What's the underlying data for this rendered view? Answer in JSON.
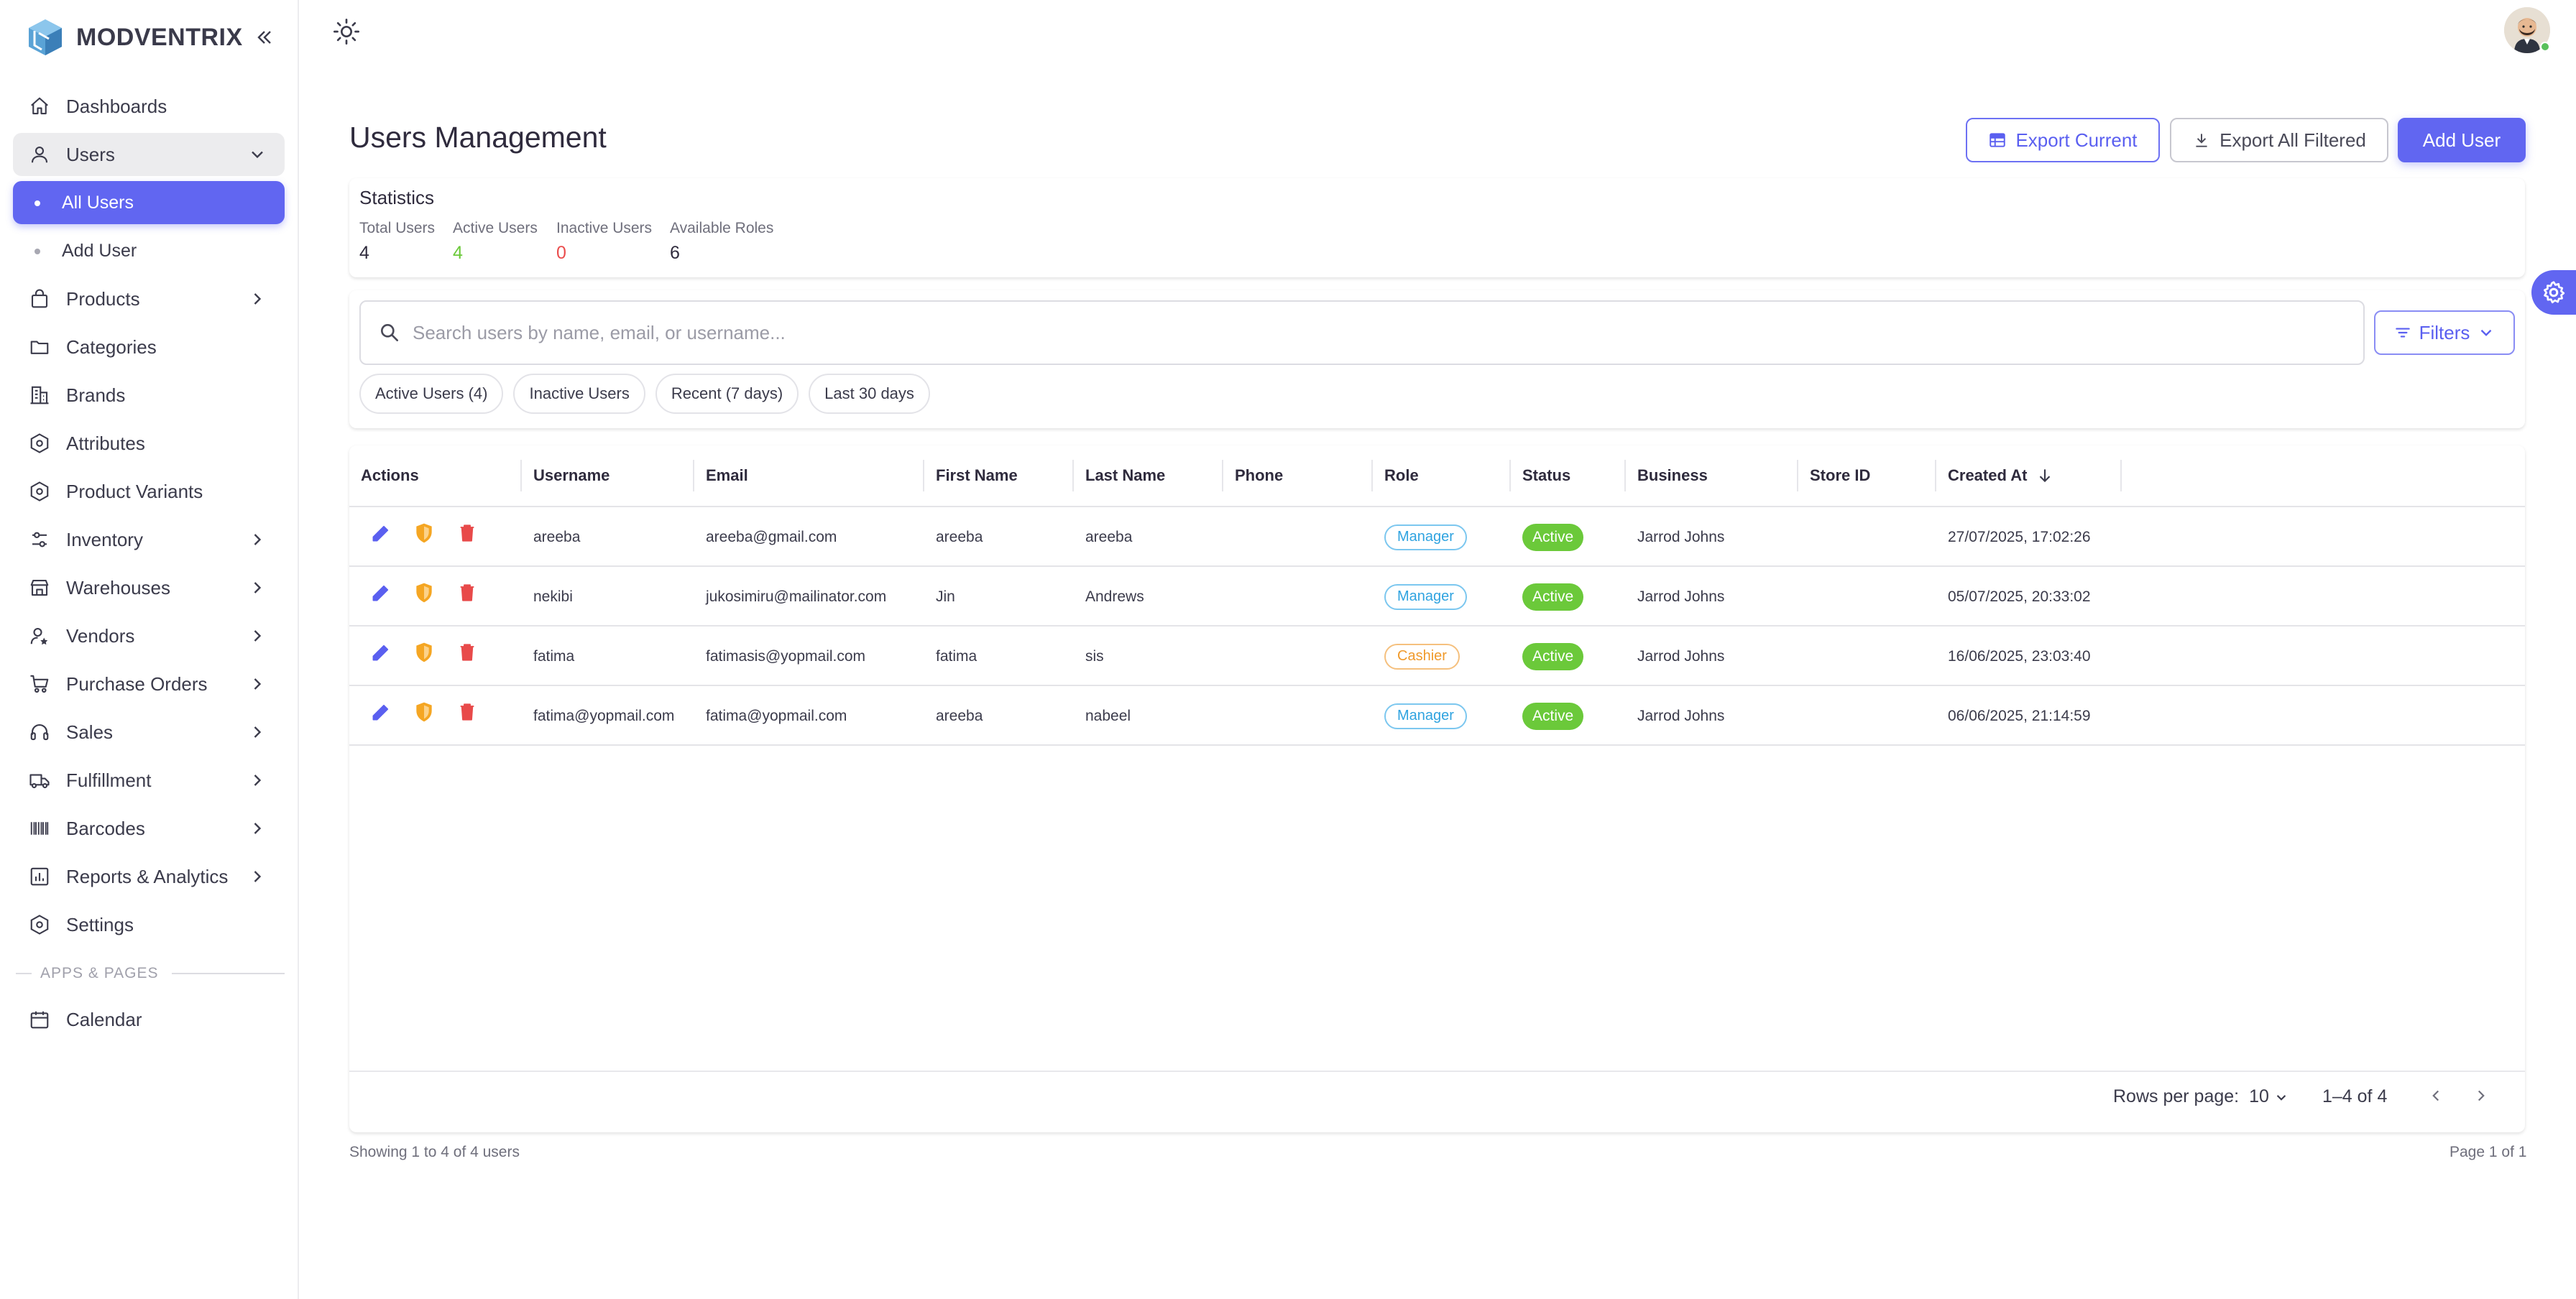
{
  "app": {
    "name": "MODVENTRIX"
  },
  "colors": {
    "accent": "#6166f1",
    "success": "#6bc93a",
    "danger": "#ea4d4d",
    "info": "#2fa3e0",
    "warning": "#f09a2b"
  },
  "sidebar": {
    "items": [
      {
        "label": "Dashboards",
        "icon": "home-icon"
      },
      {
        "label": "Users",
        "icon": "user-icon",
        "expanded": true,
        "children": [
          {
            "label": "All Users",
            "active": true
          },
          {
            "label": "Add User"
          }
        ]
      },
      {
        "label": "Products",
        "icon": "bag-icon"
      },
      {
        "label": "Categories",
        "icon": "folder-icon"
      },
      {
        "label": "Brands",
        "icon": "building-icon"
      },
      {
        "label": "Attributes",
        "icon": "hexagon-icon"
      },
      {
        "label": "Product Variants",
        "icon": "hexagon-icon"
      },
      {
        "label": "Inventory",
        "icon": "sliders-icon"
      },
      {
        "label": "Warehouses",
        "icon": "store-icon"
      },
      {
        "label": "Vendors",
        "icon": "user-star-icon"
      },
      {
        "label": "Purchase Orders",
        "icon": "cart-icon"
      },
      {
        "label": "Sales",
        "icon": "headset-icon"
      },
      {
        "label": "Fulfillment",
        "icon": "truck-icon"
      },
      {
        "label": "Barcodes",
        "icon": "barcode-icon"
      },
      {
        "label": "Reports & Analytics",
        "icon": "chart-icon"
      },
      {
        "label": "Settings",
        "icon": "gear-icon"
      }
    ],
    "section_label": "APPS & PAGES",
    "apps": [
      {
        "label": "Calendar",
        "icon": "calendar-icon"
      }
    ]
  },
  "page": {
    "title": "Users Management",
    "buttons": {
      "export_current": "Export Current",
      "export_all": "Export All Filtered",
      "add_user": "Add User"
    }
  },
  "stats": {
    "title": "Statistics",
    "items": [
      {
        "label": "Total Users",
        "value": "4"
      },
      {
        "label": "Active Users",
        "value": "4"
      },
      {
        "label": "Inactive Users",
        "value": "0"
      },
      {
        "label": "Available Roles",
        "value": "6"
      }
    ]
  },
  "search": {
    "placeholder": "Search users by name, email, or username...",
    "filters_label": "Filters",
    "chips": [
      "Active Users (4)",
      "Inactive Users",
      "Recent (7 days)",
      "Last 30 days"
    ]
  },
  "table": {
    "columns": [
      "Actions",
      "Username",
      "Email",
      "First Name",
      "Last Name",
      "Phone",
      "Role",
      "Status",
      "Business",
      "Store ID",
      "Created At"
    ],
    "sort": {
      "column": "Created At",
      "direction": "desc"
    },
    "rows": [
      {
        "username": "areeba",
        "email": "areeba@gmail.com",
        "first_name": "areeba",
        "last_name": "areeba",
        "phone": "",
        "role": "Manager",
        "status": "Active",
        "business": "Jarrod Johns",
        "store_id": "",
        "created_at": "27/07/2025, 17:02:26"
      },
      {
        "username": "nekibi",
        "email": "jukosimiru@mailinator.com",
        "first_name": "Jin",
        "last_name": "Andrews",
        "phone": "",
        "role": "Manager",
        "status": "Active",
        "business": "Jarrod Johns",
        "store_id": "",
        "created_at": "05/07/2025, 20:33:02"
      },
      {
        "username": "fatima",
        "email": "fatimasis@yopmail.com",
        "first_name": "fatima",
        "last_name": "sis",
        "phone": "",
        "role": "Cashier",
        "status": "Active",
        "business": "Jarrod Johns",
        "store_id": "",
        "created_at": "16/06/2025, 23:03:40"
      },
      {
        "username": "fatima@yopmail.com",
        "email": "fatima@yopmail.com",
        "first_name": "areeba",
        "last_name": "nabeel",
        "phone": "",
        "role": "Manager",
        "status": "Active",
        "business": "Jarrod Johns",
        "store_id": "",
        "created_at": "06/06/2025, 21:14:59"
      }
    ],
    "pagination": {
      "rows_per_page_label": "Rows per page:",
      "rows_per_page": "10",
      "range": "1–4 of 4"
    }
  },
  "footer": {
    "showing": "Showing 1 to 4 of 4 users",
    "page_of": "Page 1 of 1"
  }
}
